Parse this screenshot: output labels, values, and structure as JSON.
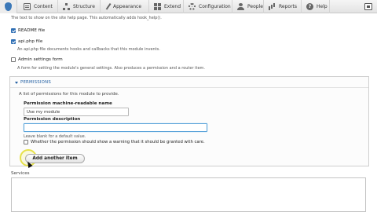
{
  "toolbar": {
    "items": [
      {
        "label": "Content",
        "icon": "content-icon"
      },
      {
        "label": "Structure",
        "icon": "structure-icon"
      },
      {
        "label": "Appearance",
        "icon": "appearance-icon"
      },
      {
        "label": "Extend",
        "icon": "extend-icon"
      },
      {
        "label": "Configuration",
        "icon": "configuration-icon"
      },
      {
        "label": "People",
        "icon": "people-icon"
      },
      {
        "label": "Reports",
        "icon": "reports-icon"
      },
      {
        "label": "Help",
        "icon": "help-icon"
      }
    ]
  },
  "form": {
    "help_desc": "The text to show on the site help page. This automatically adds hook_help().",
    "readme_label": "README file",
    "readme_checked": true,
    "apiphp_label": "api.php file",
    "apiphp_checked": true,
    "apiphp_desc": "An api.php file documents hooks and callbacks that this module invents.",
    "admin_label": "Admin settings form",
    "admin_checked": false,
    "admin_desc": "A form for setting the module's general settings. Also produces a permission and a router item.",
    "permissions": {
      "legend": "PERMISSIONS",
      "desc": "A list of permissions for this module to provide.",
      "machine_name_label": "Permission machine-readable name",
      "machine_name_value": "Use my module",
      "description_label": "Permission description",
      "description_value": "",
      "description_help": "Leave blank for a default value.",
      "warning_label": "Whether the permission should show a warning that it should be granted with care.",
      "warning_checked": false
    },
    "add_item_label": "Add another item",
    "services_label": "Services"
  },
  "colors": {
    "accent": "#2561a3",
    "focus": "#5aa3d9",
    "cursor_highlight": "#e6e14a"
  }
}
